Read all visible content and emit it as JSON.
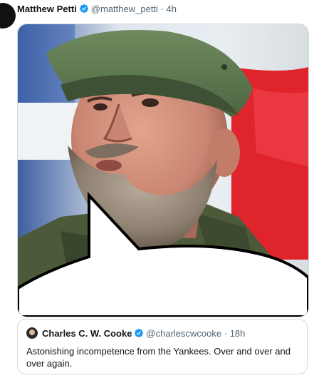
{
  "tweet": {
    "author_name": "Matthew Petti",
    "author_handle": "@matthew_petti",
    "separator": "·",
    "time": "4h"
  },
  "quote": {
    "author_name": "Charles C. W. Cooke",
    "author_handle": "@charlescwcooke",
    "separator": "·",
    "time": "18h",
    "text": "Astonishing incompetence from the Yankees. Over and over and over again."
  },
  "colors": {
    "verified": "#1d9bf0",
    "text": "#0f1419",
    "muted": "#536471",
    "border": "#cfd9de"
  },
  "icons": [
    "verified-badge-icon"
  ]
}
